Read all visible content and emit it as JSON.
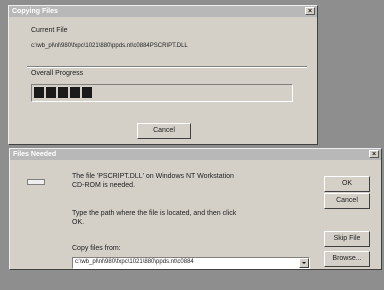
{
  "copy_dialog": {
    "title": "Copying Files",
    "close_glyph": "×",
    "current_file_label": "Current File",
    "current_file_path": "c:\\wb_pl\\nl\\980\\fxpc\\1021\\880\\ppds.nt\\c0884PSCRIPT.DLL",
    "overall_progress_label": "Overall Progress",
    "progress_fraction": 0.26,
    "progress_blocks": 5,
    "cancel_label": "Cancel"
  },
  "needed_dialog": {
    "title": "Files Needed",
    "close_glyph": "×",
    "message1": "The file 'PSCRIPT.DLL' on Windows NT Workstation",
    "message2": "CD-ROM is needed.",
    "message3": "Type the path where the file is located, and then click",
    "message4": "OK.",
    "copy_from_label": "Copy files from:",
    "copy_from_value": "c:\\wb_pl\\nl\\980\\fxpc\\1021\\880\\ppds.nt\\c0884",
    "ok_label": "OK",
    "cancel_label": "Cancel",
    "skip_label": "Skip File",
    "browse_label": "Browse..."
  }
}
